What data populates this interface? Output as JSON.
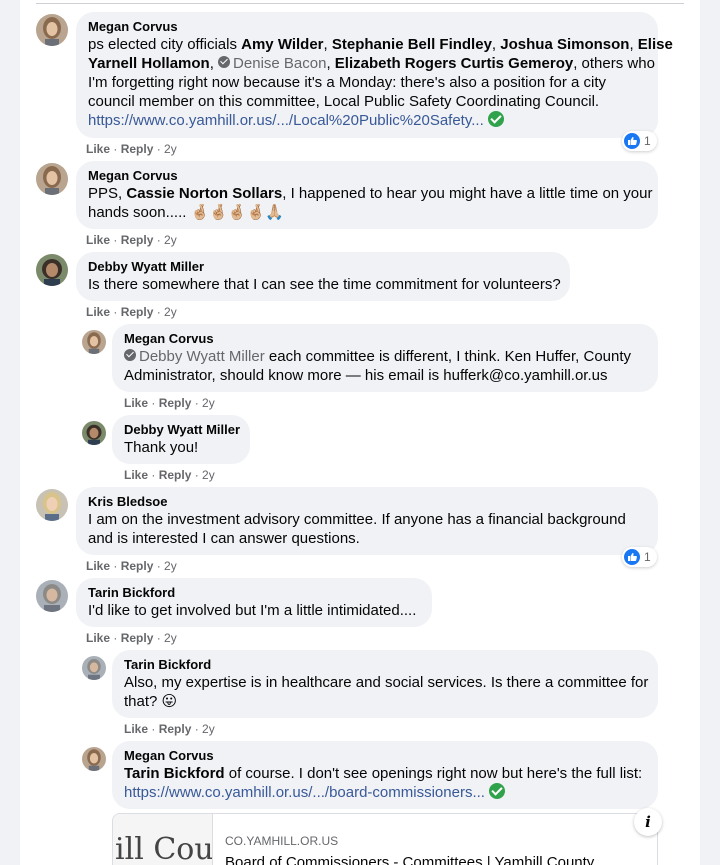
{
  "comments": {
    "c1": {
      "author": "Megan Corvus",
      "line1_pre": "ps elected city officials ",
      "m1": "Amy Wilder",
      "sep1": ", ",
      "m2": "Stephanie Bell Findley",
      "sep2": ", ",
      "m3": "Joshua Simonson",
      "sep3": ", ",
      "m4a": "Elise",
      "m4b": "Yarnell Hollamon",
      "sep4": ", ",
      "m5": "Denise Bacon",
      "sep5": ", ",
      "m6": "Elizabeth Rogers Curtis Gemeroy",
      "line2_post": ", others who",
      "line3": "I'm forgetting right now because it's a Monday: there's also a position for a city",
      "line4": "council member on this committee, Local Public Safety Coordinating Council.",
      "link": "https://www.co.yamhill.or.us/.../Local%20Public%20Safety...",
      "like": "Like",
      "reply": "Reply",
      "time": "2y",
      "reactions": "1"
    },
    "c2": {
      "author": "Megan Corvus",
      "pre": "PPS, ",
      "mention": "Cassie Norton Sollars",
      "post": ", I happened to hear you might have a little time on your",
      "line2": "hands soon..... 🤞🏼🤞🏼🤞🏼🤞🏼🙏🏼",
      "like": "Like",
      "reply": "Reply",
      "time": "2y"
    },
    "c3": {
      "author": "Debby Wyatt Miller",
      "text": "Is there somewhere that I can see the time commitment for volunteers?",
      "like": "Like",
      "reply": "Reply",
      "time": "2y"
    },
    "r1": {
      "author": "Megan Corvus",
      "mention": "Debby Wyatt Miller",
      "post": " each committee is different, I think. Ken Huffer, County",
      "line2": "Administrator, should know more — his email is hufferk@co.yamhill.or.us",
      "like": "Like",
      "reply": "Reply",
      "time": "2y"
    },
    "r2": {
      "author": "Debby Wyatt Miller",
      "text": "Thank you!",
      "like": "Like",
      "reply": "Reply",
      "time": "2y"
    },
    "c4": {
      "author": "Kris Bledsoe",
      "line1": "I am on the investment advisory committee. If anyone has a financial background",
      "line2": "and is interested I can answer questions.",
      "like": "Like",
      "reply": "Reply",
      "time": "2y",
      "reactions": "1"
    },
    "c5": {
      "author": "Tarin Bickford",
      "text": "I'd like to get involved but I'm a little intimidated....",
      "like": "Like",
      "reply": "Reply",
      "time": "2y"
    },
    "r3": {
      "author": "Tarin Bickford",
      "line1": "Also, my expertise is in healthcare and social services. Is there a committee for",
      "line2": "that? 😛",
      "like": "Like",
      "reply": "Reply",
      "time": "2y"
    },
    "r4": {
      "author": "Megan Corvus",
      "mention": "Tarin Bickford",
      "post": " of course. I don't see openings right now but here's the full list:",
      "link": "https://www.co.yamhill.or.us/.../board-commissioners..."
    }
  },
  "preview": {
    "image_text": "ill Coun",
    "domain": "CO.YAMHILL.OR.US",
    "title": "Board of Commissioners - Committees | Yamhill County",
    "info": "i"
  },
  "separator": " · ",
  "colors": {
    "link": "#385898",
    "like_blue": "#1877f2",
    "check_green": "#31a24c",
    "bubble": "#f0f2f5"
  }
}
